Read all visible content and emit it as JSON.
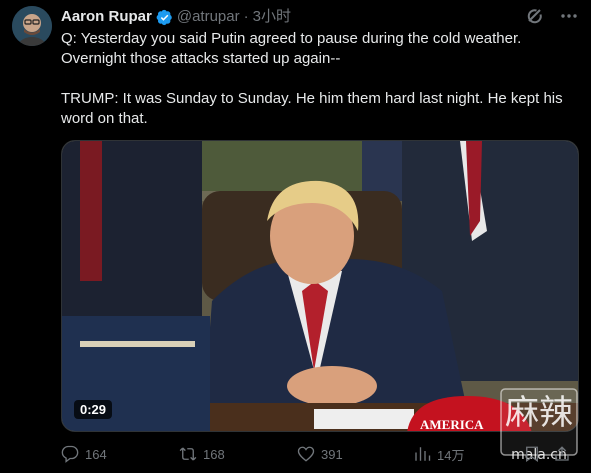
{
  "post": {
    "author_name": "Aaron Rupar",
    "handle": "@atrupar",
    "separator": "·",
    "time": "3小时",
    "text_line1": "Q: Yesterday you said Putin agreed to pause during the cold weather.",
    "text_line2": "Overnight those attacks started up again--",
    "text_line3": "TRUMP: It was Sunday to Sunday. He him them hard last night. He kept his",
    "text_line4": "word on that."
  },
  "media": {
    "duration": "0:29",
    "hat_text": "AMERICA",
    "watermark_text": "麻辣",
    "watermark_sub": "mala.cn"
  },
  "actions": {
    "replies": "164",
    "reposts": "168",
    "likes": "391",
    "views": "14万"
  },
  "icons": {
    "verified": "verified-badge-icon",
    "grok": "grok-icon",
    "more": "more-icon",
    "reply": "reply-icon",
    "repost": "repost-icon",
    "like": "heart-icon",
    "views": "views-chart-icon",
    "bookmark": "bookmark-icon",
    "share": "share-icon"
  },
  "colors": {
    "background": "#000000",
    "text": "#e7e9ea",
    "muted": "#71767b",
    "verified": "#1d9bf0"
  }
}
